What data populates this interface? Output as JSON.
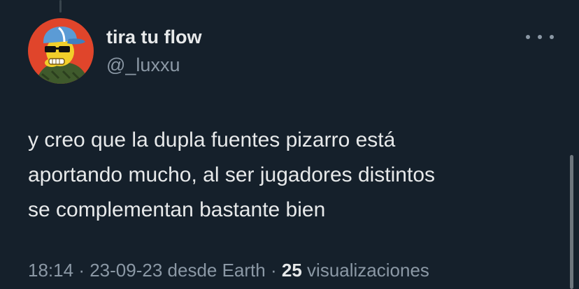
{
  "tweet": {
    "display_name": "tira tu flow",
    "handle": "@_luxxu",
    "text": "y creo que la dupla  fuentes pizarro está\naportando mucho, al ser jugadores distintos\nse complementan bastante bien",
    "time": "18:14",
    "separator": "·",
    "date": "23-09-23",
    "source": "desde Earth",
    "views_count": "25",
    "views_label": "visualizaciones"
  },
  "icons": {
    "more": "more-dots-icon",
    "avatar": "cartoon-avatar-cap-sunglasses"
  },
  "colors": {
    "background": "#15202b",
    "primary_text": "#e7e9ea",
    "secondary_text": "#8b98a5",
    "avatar_bg": "#e0452b"
  }
}
